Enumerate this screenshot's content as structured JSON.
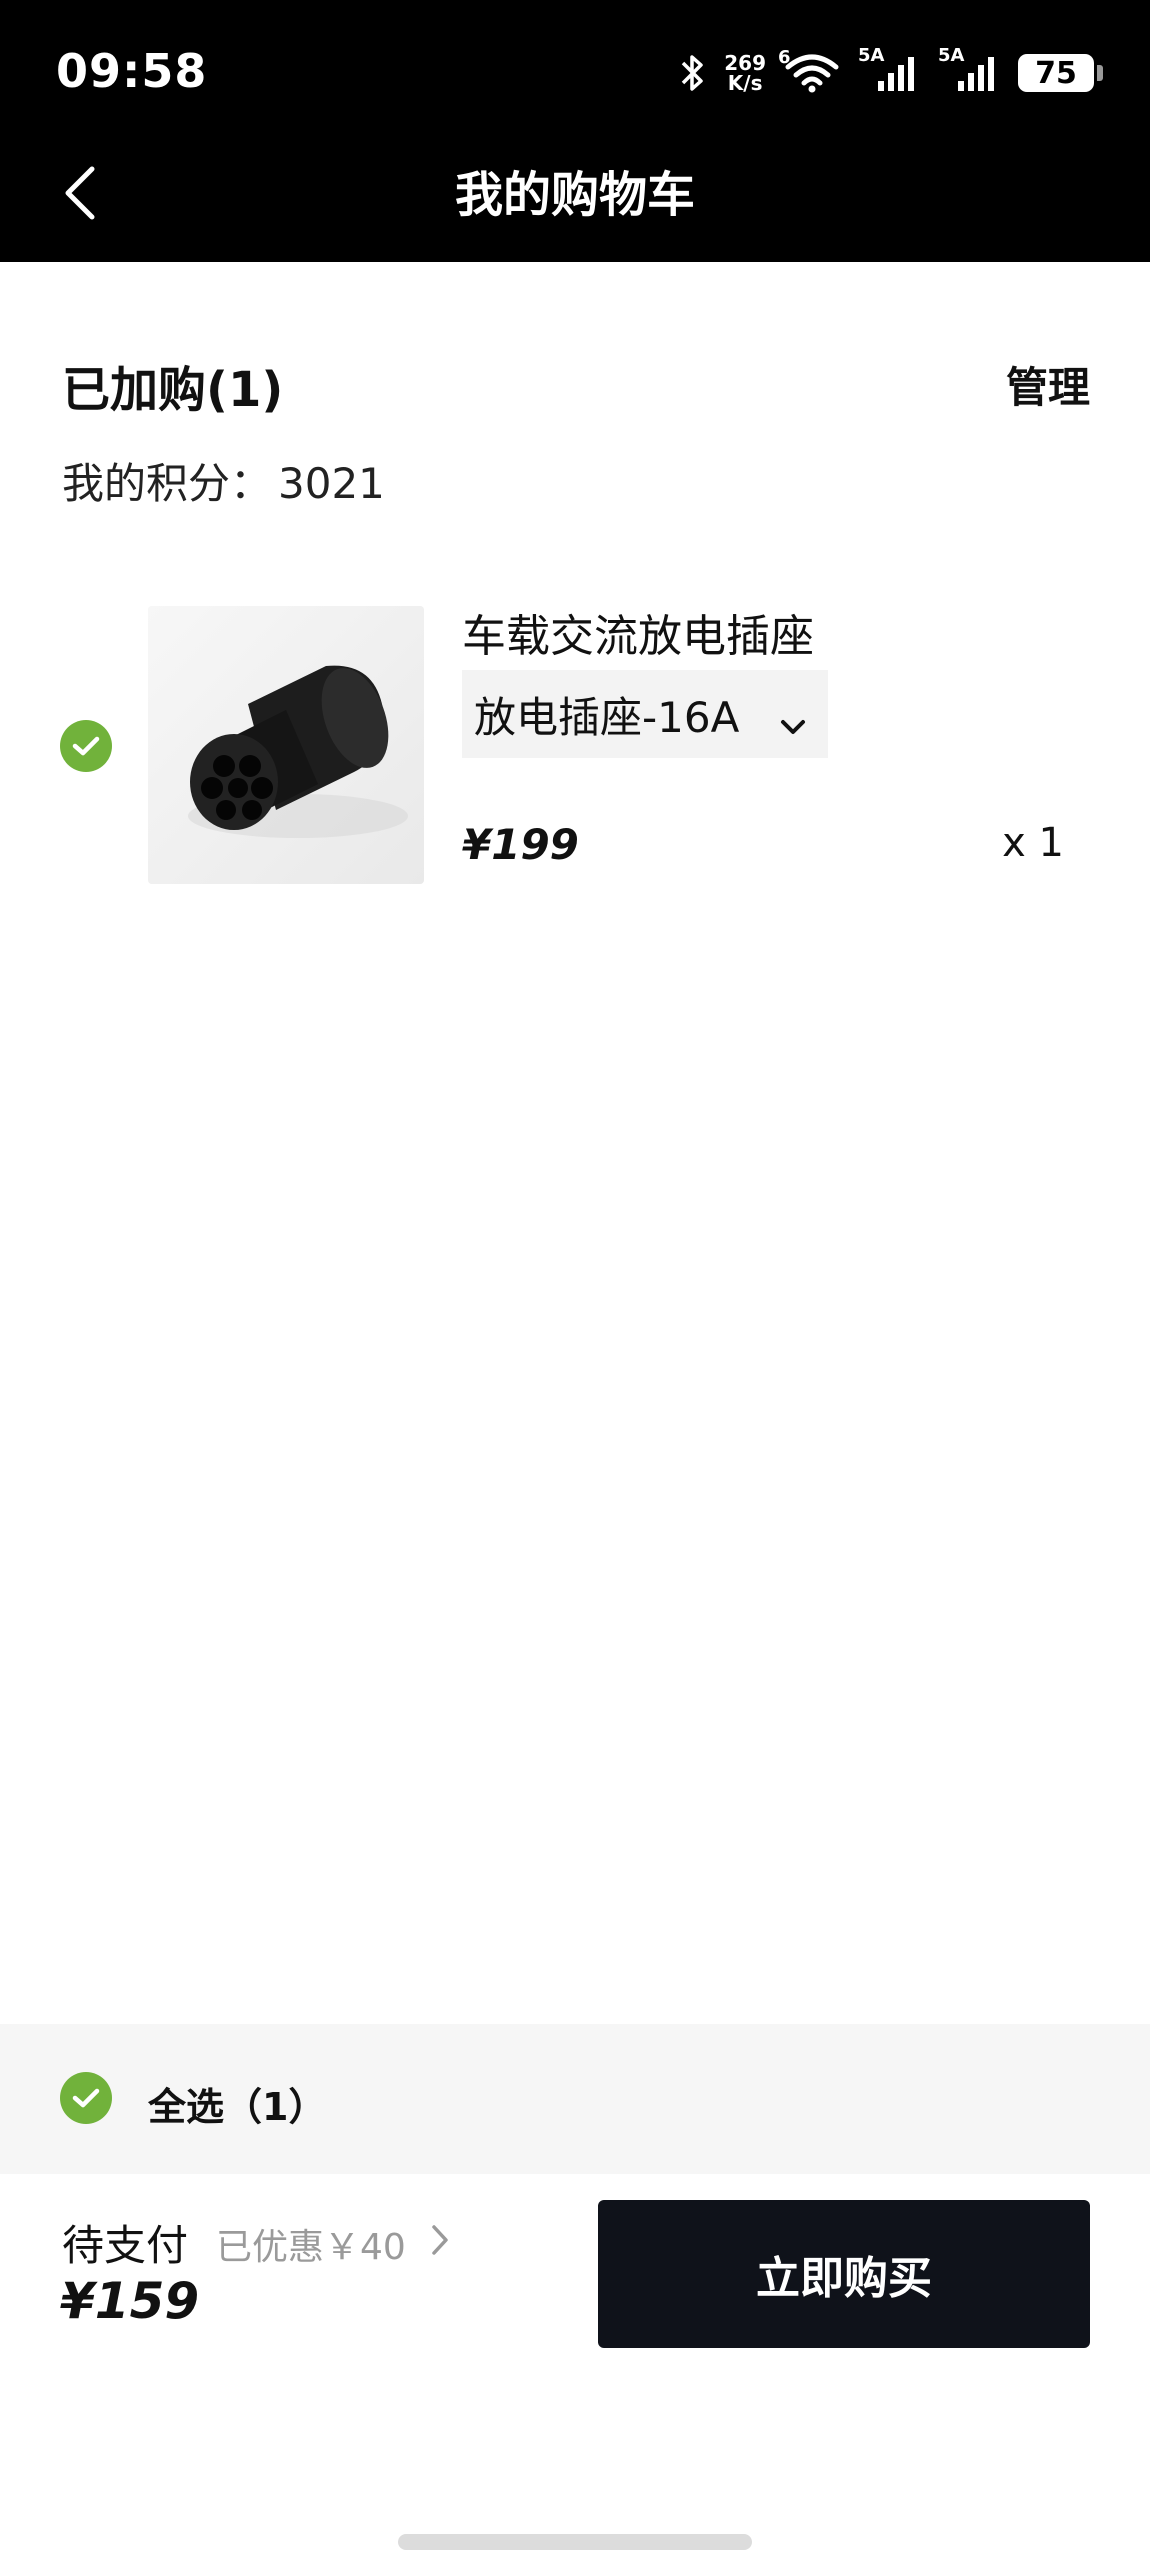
{
  "status_bar": {
    "time": "09:58",
    "net_speed_value": "269",
    "net_speed_unit": "K/s",
    "wifi_badge": "6",
    "signal1_label": "5A",
    "signal2_label": "5A",
    "battery": "75"
  },
  "header": {
    "title": "我的购物车",
    "back_icon": "chevron-left-icon"
  },
  "cart": {
    "added_label": "已加购(1)",
    "manage_label": "管理",
    "points_label": "我的积分：",
    "points_value": "3021"
  },
  "items": [
    {
      "name": "车载交流放电插座",
      "variant": "放电插座-16A",
      "price": "¥199",
      "quantity": "x 1",
      "checked": true
    }
  ],
  "footer": {
    "select_all_label": "全选（1）",
    "pay_label": "待支付",
    "discount_label": "已优惠￥40",
    "total": "¥159",
    "buy_label": "立即购买"
  },
  "colors": {
    "accent_green": "#71b23b",
    "button_dark": "#0f121a",
    "header_bg": "#000000"
  }
}
